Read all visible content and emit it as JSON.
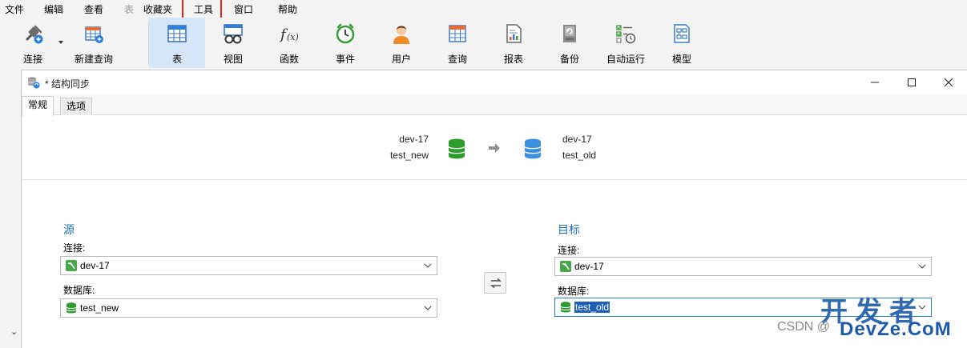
{
  "menu": {
    "items": [
      {
        "label": "文件"
      },
      {
        "label": "编辑"
      },
      {
        "label": "查看"
      },
      {
        "label": "表"
      },
      {
        "label": "收藏夹"
      },
      {
        "label": "工具"
      },
      {
        "label": "窗口"
      },
      {
        "label": "帮助"
      }
    ]
  },
  "toolbar": {
    "items": [
      {
        "label": "连接",
        "icon": "connect-plug-icon"
      },
      {
        "label": "新建查询",
        "icon": "new-query-icon"
      },
      {
        "label": "表",
        "icon": "table-icon",
        "active": true
      },
      {
        "label": "视图",
        "icon": "view-glasses-icon"
      },
      {
        "label": "函数",
        "icon": "function-fx-icon"
      },
      {
        "label": "事件",
        "icon": "event-clock-icon"
      },
      {
        "label": "用户",
        "icon": "user-icon"
      },
      {
        "label": "查询",
        "icon": "query-icon"
      },
      {
        "label": "报表",
        "icon": "report-icon"
      },
      {
        "label": "备份",
        "icon": "backup-icon"
      },
      {
        "label": "自动运行",
        "icon": "autorun-icon"
      },
      {
        "label": "模型",
        "icon": "model-icon"
      }
    ]
  },
  "window": {
    "title": "* 结构同步"
  },
  "tabs": [
    {
      "label": "常规",
      "active": true
    },
    {
      "label": "选项",
      "active": false
    }
  ],
  "summary": {
    "source_connection": "dev-17",
    "source_database": "test_new",
    "target_connection": "dev-17",
    "target_database": "test_old"
  },
  "source": {
    "title": "源",
    "connection_label": "连接:",
    "connection_value": "dev-17",
    "database_label": "数据库:",
    "database_value": "test_new"
  },
  "target": {
    "title": "目标",
    "connection_label": "连接:",
    "connection_value": "dev-17",
    "database_label": "数据库:",
    "database_value": "test_old"
  },
  "watermark": {
    "csdn": "CSDN @",
    "brand_cn": "开发者",
    "brand_site": "DevZe.CoM"
  },
  "colors": {
    "accent": "#1f6fb2",
    "source_db": "#2e9b2e",
    "target_db": "#3d8fe0",
    "highlight_box": "#e0241b",
    "active_tool": "#d4e6f7"
  }
}
